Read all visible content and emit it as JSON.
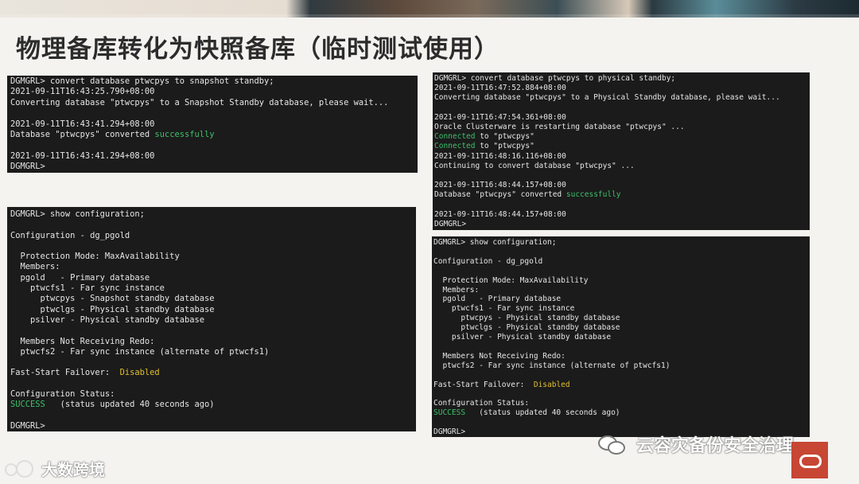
{
  "title": "物理备库转化为快照备库（临时测试使用）",
  "colors": {
    "terminal_bg": "#1b1b1b",
    "terminal_text": "#e6e6e6",
    "success": "#3ec06a",
    "disabled": "#e0c030",
    "oracle_red": "#c74634"
  },
  "terminal_convert_snapshot": [
    {
      "text": "DGMGRL> convert database ptwcpys to snapshot standby;"
    },
    {
      "text": "2021-09-11T16:43:25.790+08:00"
    },
    {
      "text": "Converting database \"ptwcpys\" to a Snapshot Standby database, please wait..."
    },
    {
      "text": ""
    },
    {
      "text": "2021-09-11T16:43:41.294+08:00"
    },
    {
      "text": "Database \"ptwcpys\" converted ",
      "hl": "successfully",
      "hl_class": "grn"
    },
    {
      "text": ""
    },
    {
      "text": "2021-09-11T16:43:41.294+08:00"
    },
    {
      "text": "DGMGRL>"
    }
  ],
  "terminal_convert_physical": [
    {
      "text": "DGMGRL> convert database ptwcpys to physical standby;"
    },
    {
      "text": "2021-09-11T16:47:52.884+08:00"
    },
    {
      "text": "Converting database \"ptwcpys\" to a Physical Standby database, please wait..."
    },
    {
      "text": ""
    },
    {
      "text": "2021-09-11T16:47:54.361+08:00"
    },
    {
      "text": "Oracle Clusterware is restarting database \"ptwcpys\" ..."
    },
    {
      "pre": "Connected",
      "pre_class": "grn",
      "text": " to \"ptwcpys\""
    },
    {
      "pre": "Connected",
      "pre_class": "grn",
      "text": " to \"ptwcpys\""
    },
    {
      "text": "2021-09-11T16:48:16.116+08:00"
    },
    {
      "text": "Continuing to convert database \"ptwcpys\" ..."
    },
    {
      "text": ""
    },
    {
      "text": "2021-09-11T16:48:44.157+08:00"
    },
    {
      "text": "Database \"ptwcpys\" converted ",
      "hl": "successfully",
      "hl_class": "grn"
    },
    {
      "text": ""
    },
    {
      "text": "2021-09-11T16:48:44.157+08:00"
    },
    {
      "text": "DGMGRL>"
    }
  ],
  "terminal_show_config_snapshot": [
    {
      "text": "DGMGRL> show configuration;"
    },
    {
      "text": ""
    },
    {
      "text": "Configuration - dg_pgold"
    },
    {
      "text": ""
    },
    {
      "text": "  Protection Mode: MaxAvailability"
    },
    {
      "text": "  Members:"
    },
    {
      "text": "  pgold   - Primary database"
    },
    {
      "text": "    ptwcfs1 - Far sync instance"
    },
    {
      "text": "      ptwcpys - Snapshot standby database"
    },
    {
      "text": "      ptwclgs - Physical standby database"
    },
    {
      "text": "    psilver - Physical standby database"
    },
    {
      "text": ""
    },
    {
      "text": "  Members Not Receiving Redo:"
    },
    {
      "text": "  ptwcfs2 - Far sync instance (alternate of ptwcfs1)"
    },
    {
      "text": ""
    },
    {
      "text": "Fast-Start Failover:  ",
      "hl": "Disabled",
      "hl_class": "yel"
    },
    {
      "text": ""
    },
    {
      "text": "Configuration Status:"
    },
    {
      "pre": "SUCCESS",
      "pre_class": "grn",
      "text": "   (status updated 40 seconds ago)"
    },
    {
      "text": ""
    },
    {
      "text": "DGMGRL>"
    }
  ],
  "terminal_show_config_physical": [
    {
      "text": "DGMGRL> show configuration;"
    },
    {
      "text": ""
    },
    {
      "text": "Configuration - dg_pgold"
    },
    {
      "text": ""
    },
    {
      "text": "  Protection Mode: MaxAvailability"
    },
    {
      "text": "  Members:"
    },
    {
      "text": "  pgold   - Primary database"
    },
    {
      "text": "    ptwcfs1 - Far sync instance"
    },
    {
      "text": "      ptwcpys - Physical standby database"
    },
    {
      "text": "      ptwclgs - Physical standby database"
    },
    {
      "text": "    psilver - Physical standby database"
    },
    {
      "text": ""
    },
    {
      "text": "  Members Not Receiving Redo:"
    },
    {
      "text": "  ptwcfs2 - Far sync instance (alternate of ptwcfs1)"
    },
    {
      "text": ""
    },
    {
      "text": "Fast-Start Failover:  ",
      "hl": "Disabled",
      "hl_class": "yel"
    },
    {
      "text": ""
    },
    {
      "text": "Configuration Status:"
    },
    {
      "pre": "SUCCESS",
      "pre_class": "grn",
      "text": "   (status updated 40 seconds ago)"
    },
    {
      "text": ""
    },
    {
      "text": "DGMGRL>"
    }
  ],
  "watermark_right": "云容灾备份安全治理",
  "watermark_left": "大数跨境",
  "icons": {
    "wechat": "wechat-icon",
    "brand": "brand-logo-icon",
    "oracle": "oracle-logo-icon"
  }
}
